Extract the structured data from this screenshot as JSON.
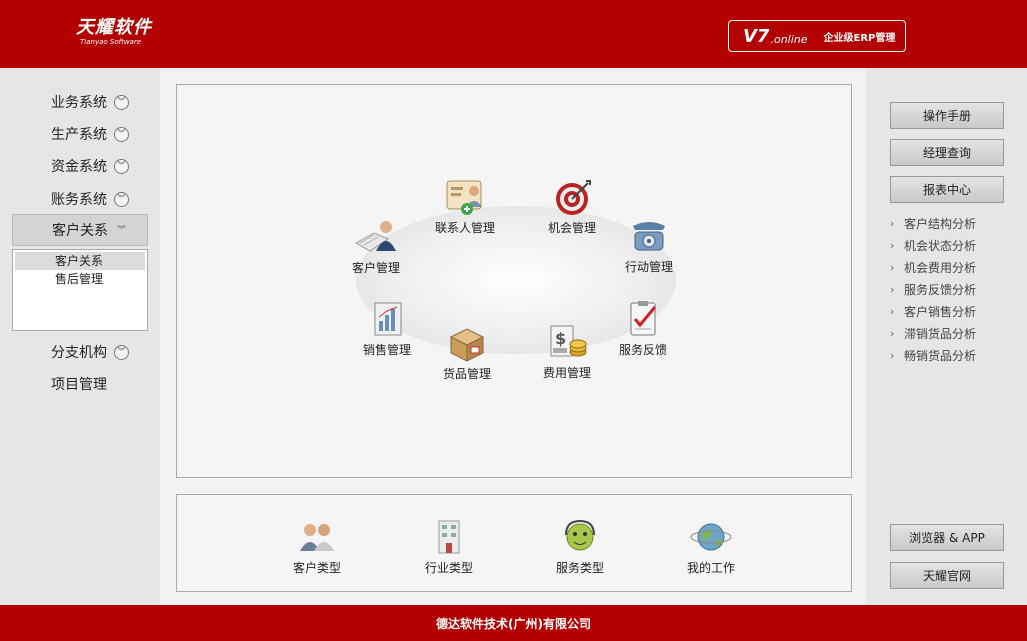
{
  "header": {
    "logo_cn": "天耀软件",
    "logo_en": "Tianyao Software",
    "version": "V7",
    "version_suffix": ".online",
    "edition": "企业级ERP管理"
  },
  "left_nav": {
    "items": [
      {
        "label": "业务系统"
      },
      {
        "label": "生产系统"
      },
      {
        "label": "资金系统"
      },
      {
        "label": "账务系统"
      },
      {
        "label": "客户关系"
      },
      {
        "label": "分支机构"
      },
      {
        "label": "项目管理"
      }
    ],
    "submenu": [
      {
        "label": "客户关系"
      },
      {
        "label": "售后管理"
      }
    ]
  },
  "modules": [
    {
      "label": "联系人管理",
      "icon": "contact-card-icon"
    },
    {
      "label": "机会管理",
      "icon": "target-icon"
    },
    {
      "label": "客户管理",
      "icon": "customer-icon"
    },
    {
      "label": "行动管理",
      "icon": "telephone-icon"
    },
    {
      "label": "销售管理",
      "icon": "sales-chart-icon"
    },
    {
      "label": "服务反馈",
      "icon": "clipboard-check-icon"
    },
    {
      "label": "货品管理",
      "icon": "goods-box-icon"
    },
    {
      "label": "费用管理",
      "icon": "money-coins-icon"
    }
  ],
  "bottom_modules": [
    {
      "label": "客户类型",
      "icon": "people-icon"
    },
    {
      "label": "行业类型",
      "icon": "industry-icon"
    },
    {
      "label": "服务类型",
      "icon": "service-icon"
    },
    {
      "label": "我的工作",
      "icon": "globe-icon"
    }
  ],
  "right_panel": {
    "buttons": [
      {
        "label": "操作手册"
      },
      {
        "label": "经理查询"
      },
      {
        "label": "报表中心"
      }
    ],
    "links": [
      {
        "label": "客户结构分析"
      },
      {
        "label": "机会状态分析"
      },
      {
        "label": "机会费用分析"
      },
      {
        "label": "服务反馈分析"
      },
      {
        "label": "客户销售分析"
      },
      {
        "label": "滞销货品分析"
      },
      {
        "label": "畅销货品分析"
      }
    ],
    "bottom_buttons": [
      {
        "label": "浏览器 & APP"
      },
      {
        "label": "天耀官网"
      }
    ]
  },
  "footer": {
    "text": "德达软件技术(广州)有限公司"
  },
  "colors": {
    "brand_red": "#b30000"
  }
}
